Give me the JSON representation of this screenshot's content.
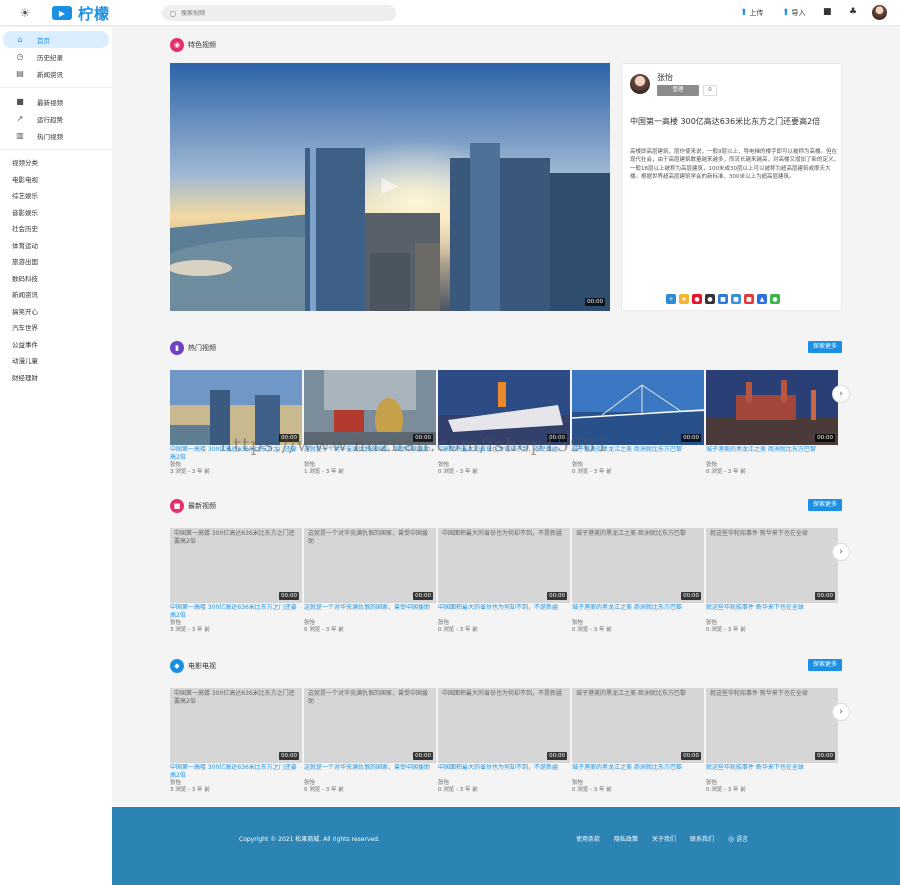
{
  "header": {
    "app_name": "柠檬",
    "search_placeholder": "搜索视频",
    "upload_label": "上传",
    "import_label": "导入"
  },
  "sidebar": {
    "main_items": [
      {
        "label": "首页",
        "icon": "home-icon",
        "active": true
      },
      {
        "label": "历史纪录",
        "icon": "history-icon"
      },
      {
        "label": "新闻资讯",
        "icon": "news-icon"
      }
    ],
    "secondary_items": [
      {
        "label": "最新视频",
        "icon": "video-icon"
      },
      {
        "label": "运行趋势",
        "icon": "trend-icon"
      },
      {
        "label": "热门视频",
        "icon": "bar-chart-icon"
      }
    ],
    "categories_title": "视频分类",
    "categories": [
      "电影电视",
      "综艺娱乐",
      "音影娱乐",
      "社会历史",
      "体育运动",
      "旅游出国",
      "数码科技",
      "新闻资讯",
      "搞笑开心",
      "汽车世界",
      "公益事件",
      "动漫儿童",
      "财经理财"
    ]
  },
  "featured": {
    "title": "特色视频",
    "duration": "00:00",
    "author": "张怡",
    "follow_label": "管理",
    "fans": "0",
    "video_title": "中国第一高楼 300亿高达636米比东方之门还要高2倍",
    "description": "高楼即高层建筑，层作使来说，一般9层以上，导电梯的楼字即可以被称为高楼。但在现代社会，由于高层建筑数量越来越多，而流长越来越高，对高楼又增加了新的定义，一般18层以上被称为高层建筑，100米或30层以上可以被称为超高层建筑或摩天大楼。根据世界超高层建筑学会的新标准，300米以上为超高层建筑。"
  },
  "hot": {
    "title": "热门视频",
    "more": "探索更多",
    "cards": [
      {
        "title": "中国第一高楼 300亿高达636米比东方之门还要高2倍",
        "author": "张怡",
        "meta": "3 浏览 - 3 年 前",
        "thumb": "city"
      },
      {
        "title": "这就是一个对华充满仇恨的国家，曾受中国援助",
        "author": "张怡",
        "meta": "1 浏览 - 3 年 前",
        "thumb": "expo"
      },
      {
        "title": "中国面积最大的省份也为何却不到，不是新疆",
        "author": "张怡",
        "meta": "0 浏览 - 3 年 前",
        "thumb": "ship"
      },
      {
        "title": "城子港美的黑龙江之美 商洲就比东方巴黎",
        "author": "张怡",
        "meta": "0 浏览 - 3 年 前",
        "thumb": "bridge"
      },
      {
        "title": "城子港美的黑龙江之美 商洲就比东方巴黎",
        "author": "张怡",
        "meta": "0 浏览 - 3 年 前",
        "thumb": "kremlin"
      }
    ]
  },
  "latest": {
    "title": "最新视频",
    "more": "探索更多",
    "cards": [
      {
        "title": "中国第一高楼 300亿高达636米比东方之门还要高2倍",
        "author": "张怡",
        "meta": "3 浏览 - 3 年 前"
      },
      {
        "title": "这就是一个对华充满仇恨的国家，曾受中国援助",
        "author": "张怡",
        "meta": "0 浏览 - 3 年 前"
      },
      {
        "title": "中国面积最大的省份也为何却不到，不是新疆",
        "author": "张怡",
        "meta": "0 浏览 - 3 年 前"
      },
      {
        "title": "城子港美的黑龙江之美 商洲就比东方巴黎",
        "author": "张怡",
        "meta": "0 浏览 - 3 年 前"
      },
      {
        "title": "就这些华轮船事件 新华来下也在全球",
        "author": "张怡",
        "meta": "0 浏览 - 3 年 前"
      }
    ]
  },
  "movie": {
    "title": "电影电视",
    "more": "探索更多",
    "cards": [
      {
        "title": "中国第一高楼 300亿高达636米比东方之门还要高2倍",
        "author": "张怡",
        "meta": "3 浏览 - 3 年 前"
      },
      {
        "title": "这就是一个对华充满仇恨的国家，曾受中国援助",
        "author": "张怡",
        "meta": "0 浏览 - 3 年 前"
      },
      {
        "title": "中国面积最大的省份也为何却不到，不是新疆",
        "author": "张怡",
        "meta": "0 浏览 - 3 年 前"
      },
      {
        "title": "城子港美的黑龙江之美 商洲就比东方巴黎",
        "author": "张怡",
        "meta": "0 浏览 - 3 年 前"
      },
      {
        "title": "就这些华轮船事件 新华来下也在全球",
        "author": "张怡",
        "meta": "0 浏览 - 3 年 前"
      }
    ]
  },
  "duration": "00:00",
  "footer": {
    "copyright": "Copyright © 2021 松果商城. All rights reserved.",
    "links": [
      "使用条款",
      "隐私政策",
      "关于我们",
      "联系我们",
      "语言"
    ]
  },
  "watermark": "https://www.huzhan.com/ishop15981",
  "colors": {
    "accent": "#1a8fe3",
    "footer": "#2b84b4",
    "featured_icon": "#e4306c",
    "hot_icon": "#6f42c1",
    "latest_icon": "#e4306c",
    "movie_icon": "#1a8fe3"
  }
}
